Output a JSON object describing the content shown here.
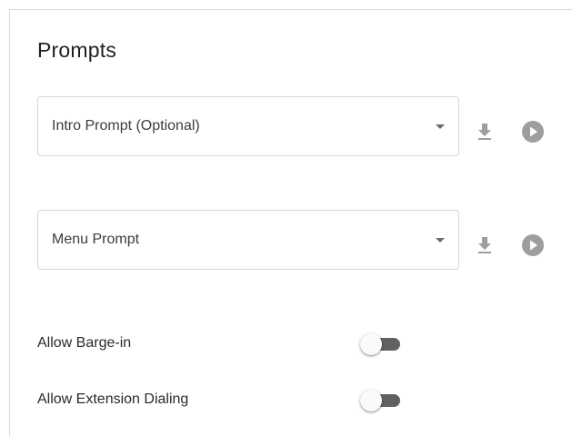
{
  "section": {
    "title": "Prompts"
  },
  "prompts": [
    {
      "label": "Intro Prompt (Optional)",
      "download_icon": "download-icon",
      "play_icon": "play-circle-icon"
    },
    {
      "label": "Menu Prompt",
      "download_icon": "download-icon",
      "play_icon": "play-circle-icon"
    }
  ],
  "toggles": [
    {
      "label": "Allow Barge-in",
      "on": false
    },
    {
      "label": "Allow Extension Dialing",
      "on": false
    }
  ],
  "colors": {
    "icon_gray": "#9e9e9e",
    "toggle_track": "#616161",
    "toggle_thumb": "#fafafa",
    "border": "#d6d6d6"
  }
}
